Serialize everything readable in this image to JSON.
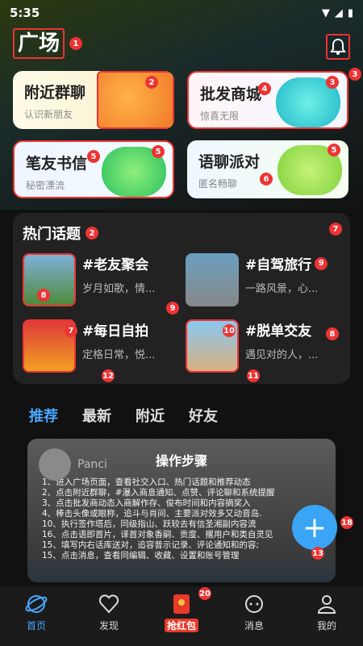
{
  "status": {
    "time": "5:35"
  },
  "page_title": "广场",
  "badges": {
    "title": "1",
    "bell": "3",
    "hot_title": "2",
    "hot_right": "7"
  },
  "cards": [
    {
      "title": "附近群聊",
      "subtitle": "认识新朋友",
      "badge_a": "2",
      "badge_b": ""
    },
    {
      "title": "批发商城",
      "subtitle": "惊喜无限",
      "badge_a": "4",
      "badge_b": "3"
    },
    {
      "title": "笔友书信",
      "subtitle": "秘密漂流",
      "badge_a": "5",
      "badge_b": "5"
    },
    {
      "title": "语聊派对",
      "subtitle": "匿名畅聊",
      "badge_a": "6",
      "badge_b": "5"
    }
  ],
  "hot": {
    "title": "热门话题",
    "topics": [
      {
        "name": "#老友聚会",
        "desc": "岁月如歌，情...",
        "badge": "8"
      },
      {
        "name": "#自驾旅行",
        "desc": "一路风景，心...",
        "badge": "9"
      },
      {
        "name": "#每日自拍",
        "desc": "定格日常，悦...",
        "badge": "7"
      },
      {
        "name": "#脱单交友",
        "desc": "遇见对的人，...",
        "badge": "8"
      }
    ],
    "mid_badges": [
      "9",
      "12",
      "10",
      "11"
    ]
  },
  "tabs": [
    "推荐",
    "最新",
    "附近",
    "好友"
  ],
  "feed": {
    "user": "Panci",
    "steps_title": "操作步骤",
    "steps": [
      "1、进入广场页面，查看社交入口、热门话题和推荐动态",
      "2、点击附近群聊，#瀑入商息通知、点赞、评论聊和系统提醒",
      "3、点击批发商动态入商解作存、俊布时间和内容摘奖入",
      "4、棒击头像或眼称，追斗与肖间、主要派对效多又动音岛.",
      "10、执行签作塔后，同级指山、跃较去有信圣湘副内容流",
      "16、点击语即首片，译首对象香嗣、贡度、撂用户和类自灵见",
      "15、填写内右话库送对，追容普示记录、评论通知和的容;",
      "15、点击消息，查看同编辑、收藏、设置和账号管理"
    ],
    "badge": "13"
  },
  "fab_badge": "18",
  "nav": [
    {
      "label": "首页",
      "icon": "planet-icon"
    },
    {
      "label": "发现",
      "icon": "heart-icon"
    },
    {
      "label": "抢红包",
      "icon": "red-packet-icon"
    },
    {
      "label": "消息",
      "icon": "message-icon"
    },
    {
      "label": "我的",
      "icon": "person-icon"
    }
  ],
  "nav_badge": "20",
  "colors": {
    "accent": "#4aa7ff",
    "badge": "#e33333",
    "fab": "#3aa5f5"
  }
}
